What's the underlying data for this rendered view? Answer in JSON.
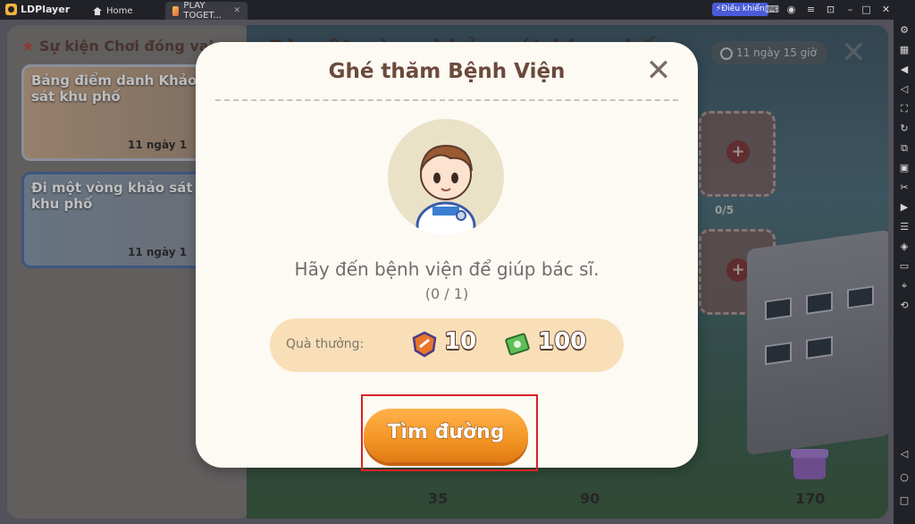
{
  "titlebar": {
    "app_name": "LDPlayer",
    "tabs": [
      {
        "label": "Home"
      },
      {
        "label": "PLAY TOGET..."
      }
    ],
    "control_badge": "Điều khiển"
  },
  "event_panel": {
    "header": "Sự kiện Chơi đóng vai",
    "cards": [
      {
        "title": "Bảng điểm danh Khảo sát khu phố",
        "time": "11 ngày 1"
      },
      {
        "title": "Đi một vòng khảo sát khu phố",
        "time": "11 ngày 1"
      }
    ]
  },
  "background": {
    "title": "Đi một vòng khảo sát khu phố",
    "timer": "11 ngày 15 giờ",
    "slot_count": "0/5",
    "milestones": [
      "35",
      "90",
      "170"
    ]
  },
  "dialog": {
    "title": "Ghé thăm Bệnh Viện",
    "task_text": "Hãy đến bệnh viện để giúp bác sĩ.",
    "progress": "(0 / 1)",
    "reward_label": "Quà thưởng:",
    "rewards": [
      {
        "icon": "badge-icon",
        "value": "10"
      },
      {
        "icon": "cash-icon",
        "value": "100"
      }
    ],
    "primary_button": "Tìm đường"
  },
  "colors": {
    "accent": "#f39423",
    "dialog_bg": "#fdf9f3",
    "title_brown": "#6b4a3c",
    "highlight_red": "#d62424"
  }
}
